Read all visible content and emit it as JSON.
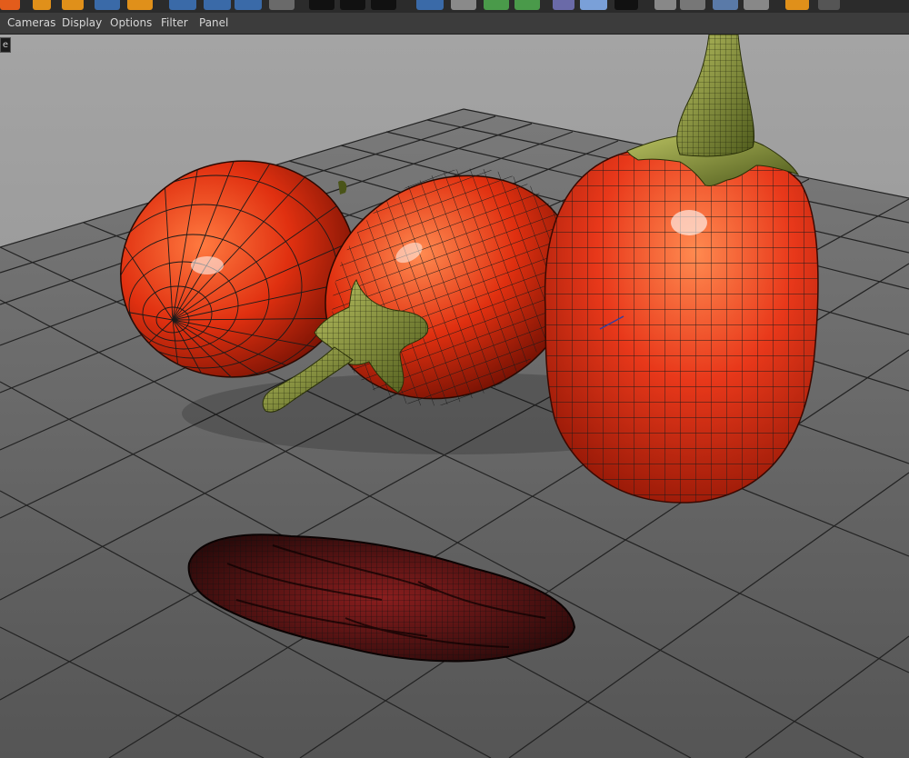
{
  "menubar": {
    "items": [
      {
        "label": "Cameras"
      },
      {
        "label": "Display"
      },
      {
        "label": "Options"
      },
      {
        "label": "Filter"
      },
      {
        "label": "Panel"
      }
    ]
  },
  "viewport": {
    "tag": "e",
    "background_color": "#9a9a9a",
    "floor_color": "#6e6e6e",
    "grid_color": "#222222",
    "mesh_color": "#1a1a1a",
    "eggplant_color": "#e03010",
    "stem_color": "#8a9a40"
  },
  "toolbar": {
    "accent_orange": "#e0901a",
    "accent_blue": "#3a6aa8"
  }
}
